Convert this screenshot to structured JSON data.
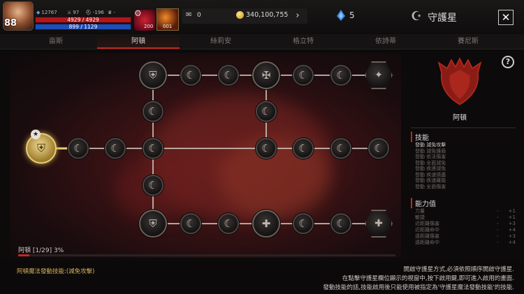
{
  "hud": {
    "level": "88",
    "stat1": "12767",
    "stat2": "97",
    "stat3": "-196",
    "stat4": "-",
    "hp": "4929 / 4929",
    "mp": "899 / 1129",
    "potion_count": "200",
    "skill_count": "001"
  },
  "currency": {
    "feather": "0",
    "gold": "340,100,755",
    "gems": "5"
  },
  "window": {
    "title": "守護星",
    "close": "✕"
  },
  "tabs": [
    "亩斯",
    "阿頓",
    "絲莉安",
    "格立特",
    "依詩蒂",
    "賽尼斯"
  ],
  "active_tab": 1,
  "progress": {
    "label": "阿頓 [1/29] 3%",
    "percent": 3
  },
  "crest": {
    "name": "阿頓"
  },
  "skills": {
    "title": "技能",
    "items": [
      "發動 減免攻擊",
      "發動 減免護盾",
      "發動 依法傷害",
      "發動 全面減免",
      "發動 疾連減免",
      "發動 疾速燒盡",
      "發動 疾速離能",
      "發動 全面傷害"
    ]
  },
  "abilities": {
    "title": "能力值",
    "rows": [
      {
        "name": "力量",
        "cur": "-",
        "bonus": "+1"
      },
      {
        "name": "敏捷",
        "cur": "-",
        "bonus": "+1"
      },
      {
        "name": "近距離傷害",
        "cur": "-",
        "bonus": "+3"
      },
      {
        "name": "近距離命中",
        "cur": "-",
        "bonus": "+4"
      },
      {
        "name": "遠距離傷害",
        "cur": "-",
        "bonus": "+3"
      },
      {
        "name": "遠距離命中",
        "cur": "-",
        "bonus": "+4"
      }
    ]
  },
  "footer": {
    "skill_note": "阿頓魔法發動技能:(減免攻擊)",
    "instructions": [
      "開啟守護星方式,必須依照順序開啟守護星.",
      "在點擊守護星欄位顯示的視窗中,按下啟用鍵,即可進入啟用的畫面.",
      "發動技能的話,技能啟用後只能使用被指定為'守護星魔法發動技能'的技能."
    ]
  },
  "icons": {
    "help": "?",
    "arrow": "›",
    "gear": "⚙",
    "start_star": "★"
  }
}
